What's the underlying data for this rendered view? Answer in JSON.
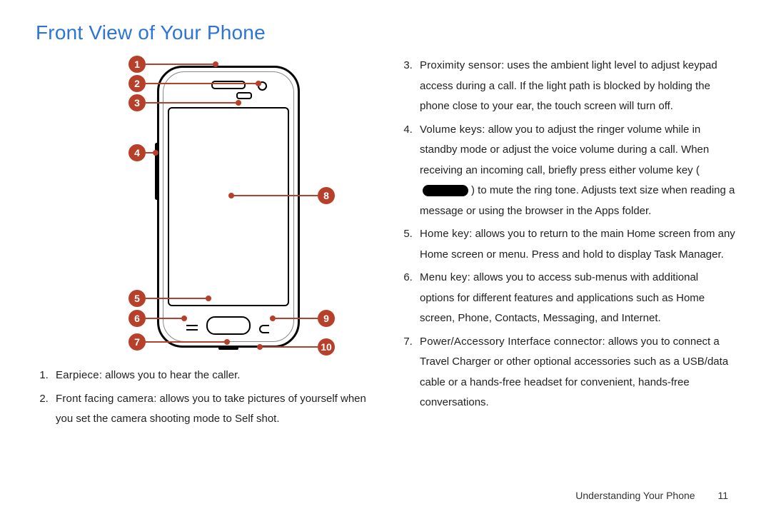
{
  "title": "Front View of Your Phone",
  "callouts": {
    "n1": "1",
    "n2": "2",
    "n3": "3",
    "n4": "4",
    "n5": "5",
    "n6": "6",
    "n7": "7",
    "n8": "8",
    "n9": "9",
    "n10": "10"
  },
  "left_list_start": 1,
  "right_list_start": 3,
  "items_left": [
    {
      "term": "Earpiece",
      "desc": ": allows you to hear the caller."
    },
    {
      "term": "Front facing camera",
      "desc": ": allows you to take pictures of yourself when you set the camera shooting mode to Self shot."
    }
  ],
  "items_right": [
    {
      "term": "Proximity sensor",
      "desc": ": uses the ambient light level to adjust keypad access during a call. If the light path is blocked by holding the phone close to your ear, the touch screen will turn off."
    },
    {
      "term": "Volume keys",
      "desc_a": ": allow you to adjust the ringer volume while in standby mode or adjust the voice volume during a call. When receiving an incoming call, briefly press either volume key (",
      "desc_b": ") to mute the ring tone. Adjusts text size when reading a message or using the browser in the Apps folder."
    },
    {
      "term": "Home key",
      "desc": ": allows you to return to the main Home screen from any Home screen or menu. Press and hold to display Task Manager."
    },
    {
      "term": "Menu key",
      "desc": ": allows you to access sub-menus with additional options for different features and applications such as Home screen, Phone, Contacts, Messaging, and Internet."
    },
    {
      "term": "Power/Accessory Interface connector",
      "desc": ": allows you to connect a Travel Charger or other optional accessories such as a USB/data cable or a hands-free headset for convenient, hands-free conversations."
    }
  ],
  "footer": {
    "section": "Understanding Your Phone",
    "page": "11"
  }
}
